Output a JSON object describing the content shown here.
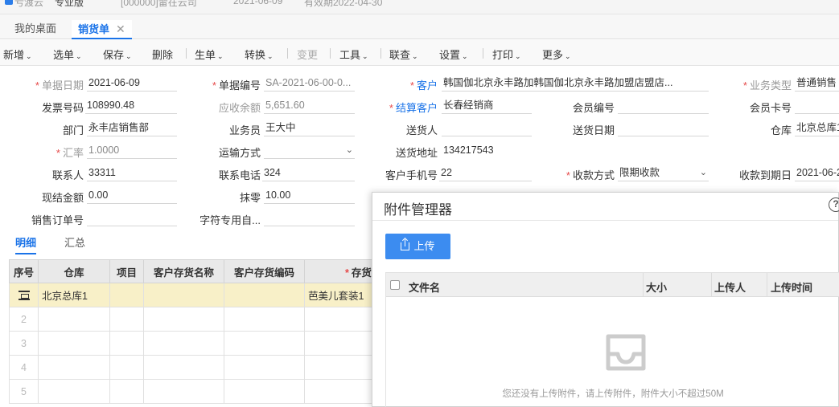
{
  "topbar": {
    "fragments": [
      "亏渡云",
      "专业版",
      "[000000]雷在云司",
      "2021-06-09",
      "有效期2022-04-30"
    ]
  },
  "tabs": [
    {
      "label": "我的桌面"
    },
    {
      "label": "销货单",
      "close": "✕"
    }
  ],
  "toolbar": {
    "items": [
      {
        "label": "新增",
        "caret": "⌄"
      },
      {
        "label": "选单",
        "caret": "⌄"
      },
      {
        "label": "保存",
        "caret": "⌄"
      },
      {
        "label": "删除"
      },
      {
        "label": "生单",
        "caret": "⌄"
      },
      {
        "label": "转换",
        "caret": "⌄"
      },
      {
        "label": "变更"
      },
      {
        "label": "工具",
        "caret": "⌄"
      },
      {
        "label": "联查",
        "caret": "⌄"
      },
      {
        "label": "设置",
        "caret": "⌄"
      },
      {
        "label": "打印",
        "caret": "⌄"
      },
      {
        "label": "更多",
        "caret": "⌄"
      }
    ]
  },
  "form": {
    "doc_date": {
      "label": "单据日期",
      "value": "2021-06-09"
    },
    "doc_no": {
      "label": "单据编号",
      "value": "SA-2021-06-00-0..."
    },
    "customer": {
      "label": "客户",
      "value": "韩国伽北京永丰路加韩国伽北京永丰路加盟店盟店..."
    },
    "biz_type": {
      "label": "业务类型",
      "value": "普通销售"
    },
    "invoice_no": {
      "label": "发票号码",
      "value": "108990.48"
    },
    "receivable": {
      "label": "应收余额",
      "value": "5,651.60"
    },
    "settle_customer": {
      "label": "结算客户",
      "value": "长春经销商"
    },
    "member_no": {
      "label": "会员编号",
      "value": ""
    },
    "member_card": {
      "label": "会员卡号",
      "value": ""
    },
    "dept": {
      "label": "部门",
      "value": "永丰店销售部"
    },
    "salesman": {
      "label": "业务员",
      "value": "王大中"
    },
    "deliverer": {
      "label": "送货人",
      "value": ""
    },
    "delivery_date": {
      "label": "送货日期",
      "value": ""
    },
    "warehouse": {
      "label": "仓库",
      "value": "北京总库1"
    },
    "rate": {
      "label": "汇率",
      "value": "1.0000"
    },
    "transport": {
      "label": "运输方式",
      "value": ""
    },
    "address": {
      "label": "送货地址",
      "value": "134217543"
    },
    "contact": {
      "label": "联系人",
      "value": "33311"
    },
    "phone": {
      "label": "联系电话",
      "value": "324"
    },
    "mobile": {
      "label": "客户手机号",
      "value": "22"
    },
    "pay_method": {
      "label": "收款方式",
      "value": "限期收款"
    },
    "due_date": {
      "label": "收款到期日",
      "value": "2021-06-2"
    },
    "cash_amount": {
      "label": "现结金额",
      "value": "0.00"
    },
    "rounding": {
      "label": "抹零",
      "value": "10.00"
    },
    "sales_order": {
      "label": "销售订单号",
      "value": ""
    },
    "char_custom": {
      "label": "字符专用自...",
      "value": ""
    }
  },
  "detail_tabs": [
    {
      "label": "明细"
    },
    {
      "label": "汇总"
    }
  ],
  "grid": {
    "headers": [
      "序号",
      "仓库",
      "项目",
      "客户存货名称",
      "客户存货编码",
      "存货"
    ],
    "rows": [
      {
        "no": "",
        "warehouse": "北京总库1",
        "item": "芭美儿套装1"
      },
      {
        "no": "2",
        "warehouse": "",
        "item": ""
      },
      {
        "no": "3",
        "warehouse": "",
        "item": ""
      },
      {
        "no": "4",
        "warehouse": "",
        "item": ""
      },
      {
        "no": "5",
        "warehouse": "",
        "item": ""
      }
    ]
  },
  "dialog": {
    "title": "附件管理器",
    "help": "?",
    "upload_label": "上传",
    "columns": {
      "name": "文件名",
      "size": "大小",
      "uploader": "上传人",
      "time": "上传时间"
    },
    "empty_text": "您还没有上传附件，请上传附件，附件大小不超过50M"
  },
  "colors": {
    "accent": "#1a73e8",
    "button": "#3c8cf0",
    "required": "#e64a4a",
    "selected_row": "#f8f0c8"
  }
}
